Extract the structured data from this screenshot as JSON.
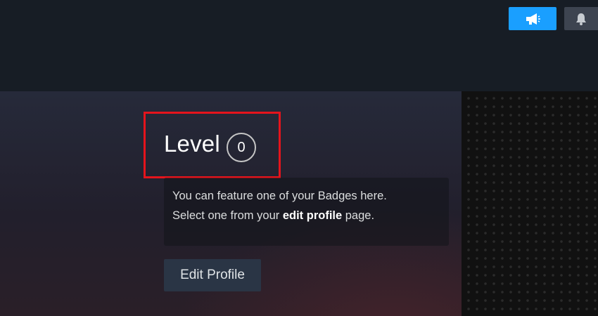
{
  "header": {
    "announcement_icon": "megaphone-icon",
    "notification_icon": "bell-icon"
  },
  "profile": {
    "level_label": "Level",
    "level_value": "0",
    "badge_message": {
      "line1": "You can feature one of your Badges here.",
      "line2_prefix": "Select one from your ",
      "line2_link": "edit profile",
      "line2_suffix": " page."
    },
    "edit_button_label": "Edit Profile"
  },
  "colors": {
    "accent": "#1a9fff",
    "highlight_border": "#e5141c"
  }
}
